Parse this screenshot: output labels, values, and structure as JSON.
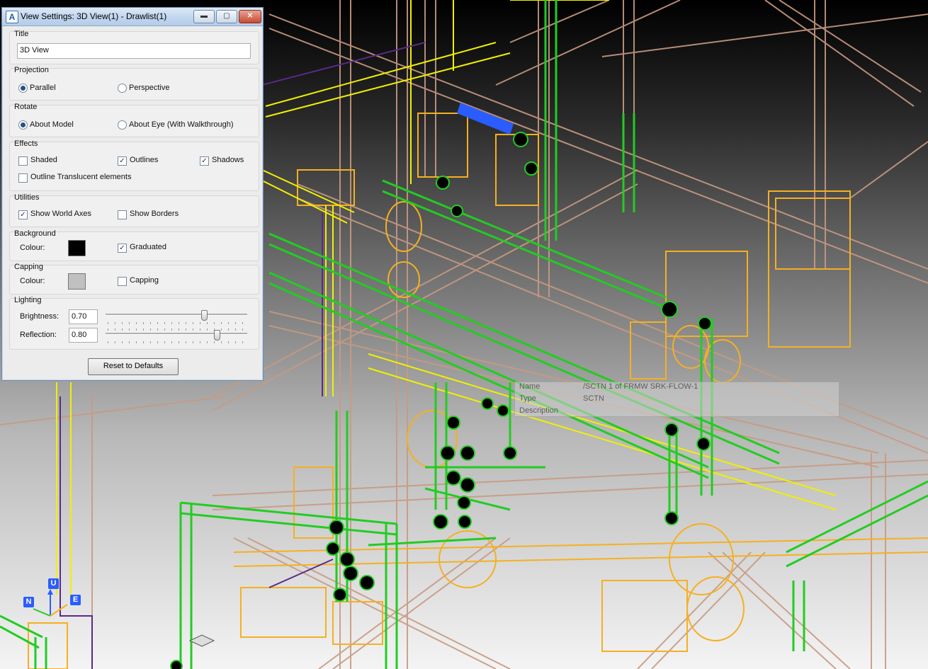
{
  "window": {
    "title": "View Settings: 3D View(1) - Drawlist(1)",
    "app_icon": "aveva-a-icon",
    "controls": {
      "minimize": "▬",
      "maximize": "▢",
      "close": "✕"
    }
  },
  "title_group": {
    "label": "Title",
    "value": "3D View"
  },
  "projection": {
    "label": "Projection",
    "options": [
      "Parallel",
      "Perspective"
    ],
    "selected": "Parallel"
  },
  "rotate": {
    "label": "Rotate",
    "options": [
      "About Model",
      "About Eye (With Walkthrough)"
    ],
    "selected": "About Model"
  },
  "effects": {
    "label": "Effects",
    "items": [
      {
        "label": "Shaded",
        "checked": false
      },
      {
        "label": "Outlines",
        "checked": true
      },
      {
        "label": "Shadows",
        "checked": true
      },
      {
        "label": "Outline Translucent elements",
        "checked": false
      }
    ]
  },
  "utilities": {
    "label": "Utilities",
    "items": [
      {
        "label": "Show World Axes",
        "checked": true
      },
      {
        "label": "Show Borders",
        "checked": false
      }
    ]
  },
  "background": {
    "label": "Background",
    "colour_label": "Colour:",
    "colour": "#000000",
    "graduated_label": "Graduated",
    "graduated": true
  },
  "capping": {
    "label": "Capping",
    "colour_label": "Colour:",
    "colour": "#c0c0c0",
    "capping_label": "Capping",
    "capping": false
  },
  "lighting": {
    "label": "Lighting",
    "brightness_label": "Brightness:",
    "brightness": "0.70",
    "reflection_label": "Reflection:",
    "reflection": "0.80"
  },
  "reset_label": "Reset to Defaults",
  "tooltip": {
    "name_label": "Name",
    "name_value": "/SCTN 1 of FRMW SRK-FLOW-1",
    "type_label": "Type",
    "type_value": "SCTN",
    "desc_label": "Description",
    "desc_value": ""
  },
  "world_axes": {
    "up": "U",
    "north": "N",
    "east": "E"
  },
  "colors": {
    "pipe_green": "#22cc22",
    "steel_tan": "#c89a82",
    "equip_orange": "#f5b020",
    "yellow": "#f0f000",
    "purple": "#5a2a8a",
    "blue": "#2a5cff"
  }
}
